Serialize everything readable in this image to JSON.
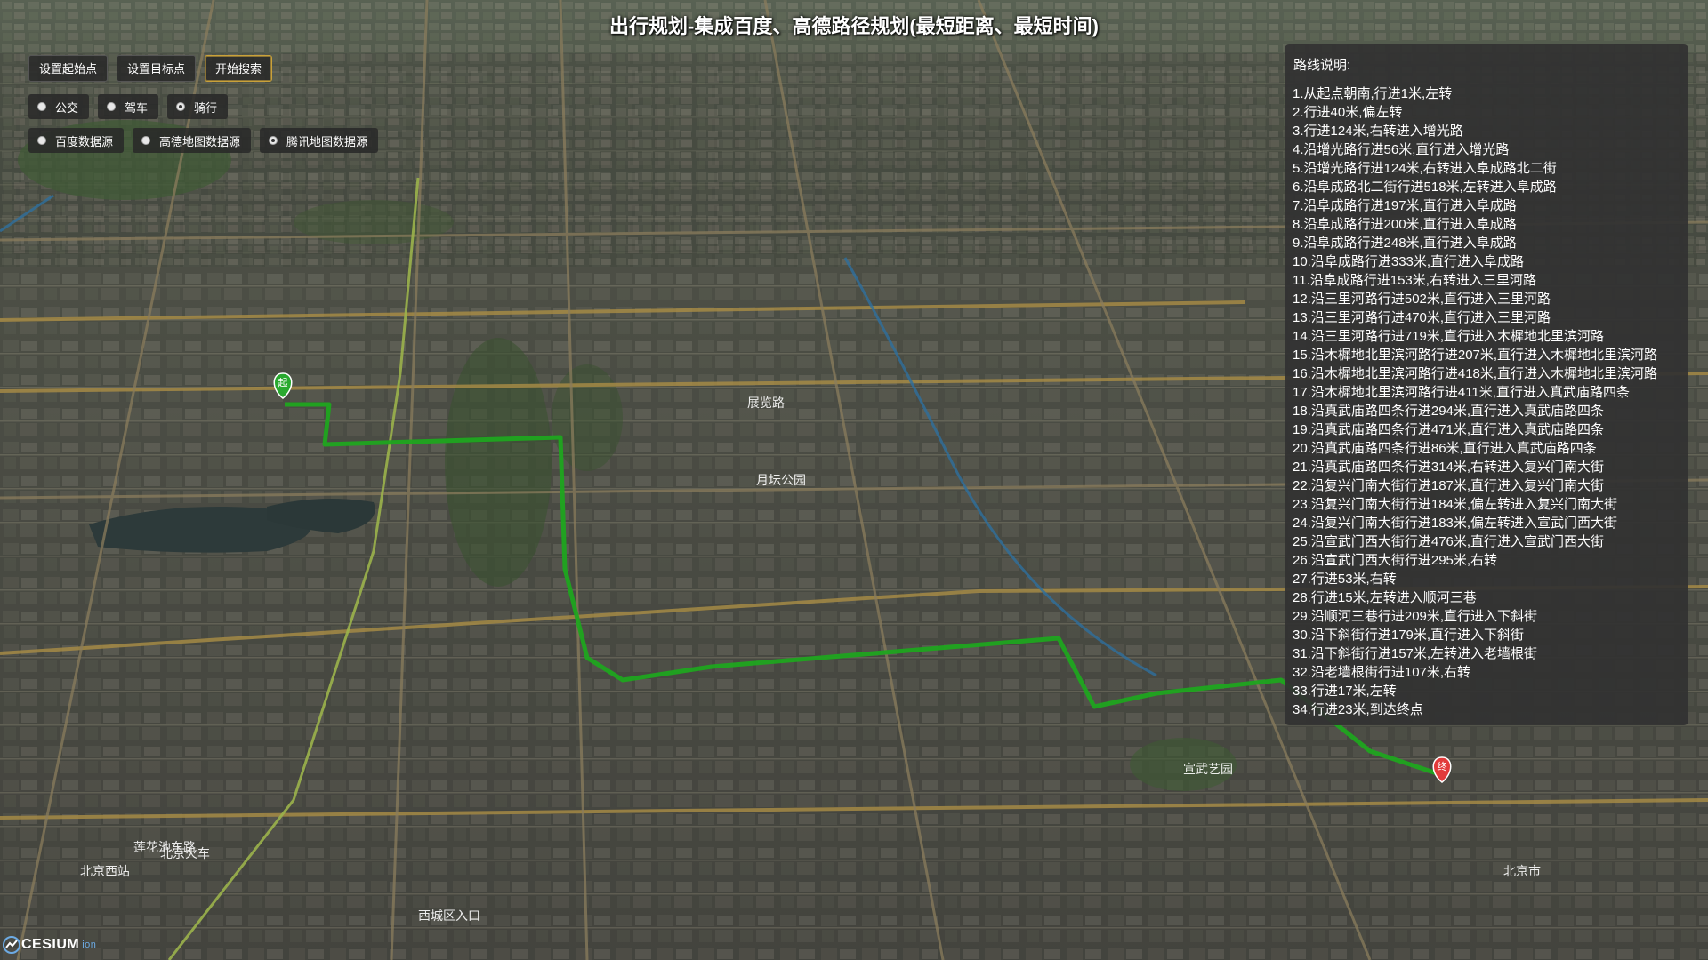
{
  "title": "出行规划-集成百度、高德路径规划(最短距离、最短时间)",
  "toolbar": {
    "set_start": "设置起始点",
    "set_end": "设置目标点",
    "start_search": "开始搜索"
  },
  "travel_modes": [
    {
      "label": "公交",
      "checked": false
    },
    {
      "label": "驾车",
      "checked": false
    },
    {
      "label": "骑行",
      "checked": true
    }
  ],
  "data_sources": [
    {
      "label": "百度数据源",
      "checked": false
    },
    {
      "label": "高德地图数据源",
      "checked": false
    },
    {
      "label": "腾讯地图数据源",
      "checked": true
    }
  ],
  "route_panel": {
    "title": "路线说明:",
    "steps": [
      "从起点朝南,行进1米,左转",
      "行进40米,偏左转",
      "行进124米,右转进入增光路",
      "沿增光路行进56米,直行进入增光路",
      "沿增光路行进124米,右转进入阜成路北二街",
      "沿阜成路北二街行进518米,左转进入阜成路",
      "沿阜成路行进197米,直行进入阜成路",
      "沿阜成路行进200米,直行进入阜成路",
      "沿阜成路行进248米,直行进入阜成路",
      "沿阜成路行进333米,直行进入阜成路",
      "沿阜成路行进153米,右转进入三里河路",
      "沿三里河路行进502米,直行进入三里河路",
      "沿三里河路行进470米,直行进入三里河路",
      "沿三里河路行进719米,直行进入木樨地北里滨河路",
      "沿木樨地北里滨河路行进207米,直行进入木樨地北里滨河路",
      "沿木樨地北里滨河路行进418米,直行进入木樨地北里滨河路",
      "沿木樨地北里滨河路行进411米,直行进入真武庙路四条",
      "沿真武庙路四条行进294米,直行进入真武庙路四条",
      "沿真武庙路四条行进471米,直行进入真武庙路四条",
      "沿真武庙路四条行进86米,直行进入真武庙路四条",
      "沿真武庙路四条行进314米,右转进入复兴门南大街",
      "沿复兴门南大街行进187米,直行进入复兴门南大街",
      "沿复兴门南大街行进184米,偏左转进入复兴门南大街",
      "沿复兴门南大街行进183米,偏左转进入宣武门西大街",
      "沿宣武门西大街行进476米,直行进入宣武门西大街",
      "沿宣武门西大街行进295米,右转",
      "行进53米,右转",
      "行进15米,左转进入顺河三巷",
      "沿顺河三巷行进209米,直行进入下斜街",
      "沿下斜街行进179米,直行进入下斜街",
      "沿下斜街行进157米,左转进入老墙根街",
      "沿老墙根街行进107米,右转",
      "行进17米,左转",
      "行进23米,到达终点"
    ]
  },
  "map": {
    "start_marker": "起",
    "end_marker": "终",
    "route_color": "#1fa51f",
    "labels": [
      "莲花池东路",
      "西城区入口",
      "宣武艺园",
      "北京西站",
      "北京火车",
      "展览路",
      "月坛公园",
      "北京市"
    ]
  },
  "logo": {
    "name": "CESIUM",
    "suffix": "ion"
  }
}
